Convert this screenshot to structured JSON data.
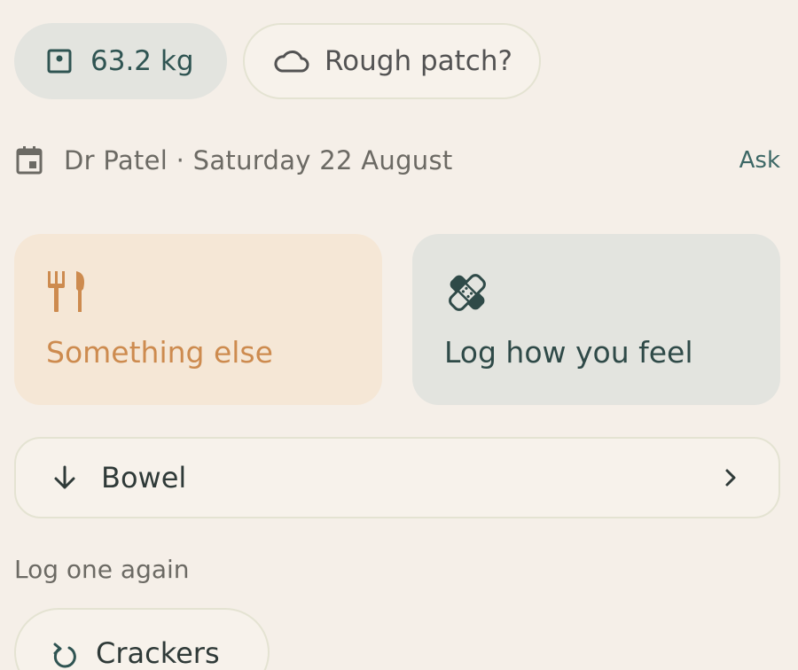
{
  "chips": {
    "weight": {
      "icon": "scale-icon",
      "label": "63.2 kg"
    },
    "rough_patch": {
      "icon": "cloud-icon",
      "label": "Rough patch?"
    }
  },
  "appointment": {
    "icon": "calendar-icon",
    "text": "Dr Patel · Saturday 22 August",
    "action": "Ask"
  },
  "cards": {
    "food": {
      "icon": "utensils-icon",
      "label": "Something else",
      "color": "#cd8b4f"
    },
    "feel": {
      "icon": "bandage-icon",
      "label": "Log how you feel",
      "color": "#2f4a48"
    }
  },
  "bowel_row": {
    "icon": "arrow-down-icon",
    "label": "Bowel",
    "chevron": "chevron-right-icon"
  },
  "log_again": {
    "title": "Log one again",
    "items": [
      {
        "icon": "redo-icon",
        "label": "Crackers"
      }
    ]
  },
  "colors": {
    "background": "#f5efe8",
    "accent": "#2f5452",
    "food_orange": "#cd8b4f"
  }
}
